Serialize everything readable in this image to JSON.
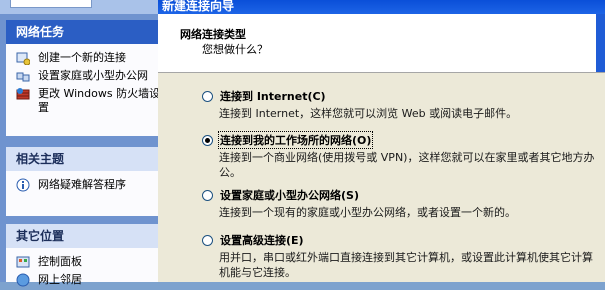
{
  "taskpane": {
    "tasks_title": "网络任务",
    "tasks": [
      {
        "label": "创建一个新的连接",
        "icon": "new-connection-icon"
      },
      {
        "label": "设置家庭或小型办公网",
        "icon": "home-network-icon"
      },
      {
        "label": "更改 Windows 防火墙设",
        "label2": "置",
        "icon": "firewall-icon"
      }
    ],
    "related_title": "相关主题",
    "related": [
      {
        "label": "网络疑难解答程序",
        "icon": "info-icon"
      }
    ],
    "other_title": "其它位置",
    "other": [
      {
        "label": "控制面板",
        "icon": "control-panel-icon"
      },
      {
        "label": "网上邻居",
        "icon": "network-places-icon"
      }
    ]
  },
  "dialog": {
    "title": "新建连接向导",
    "header_title": "网络连接类型",
    "header_subtitle": "您想做什么？",
    "options": [
      {
        "label": "连接到 Internet(C)",
        "desc": "连接到 Internet，这样您就可以浏览 Web 或阅读电子邮件。",
        "checked": false
      },
      {
        "label": "连接到我的工作场所的网络(O)",
        "desc": "连接到一个商业网络(使用拨号或 VPN)，这样您就可以在家里或者其它地方办公。",
        "checked": true
      },
      {
        "label": "设置家庭或小型办公网络(S)",
        "desc": "连接到一个现有的家庭或小型办公网络，或者设置一个新的。",
        "checked": false
      },
      {
        "label": "设置高级连接(E)",
        "desc": "用并口，串口或红外端口直接连接到其它计算机，或设置此计算机使其它计算机能与它连接。",
        "checked": false
      }
    ]
  }
}
